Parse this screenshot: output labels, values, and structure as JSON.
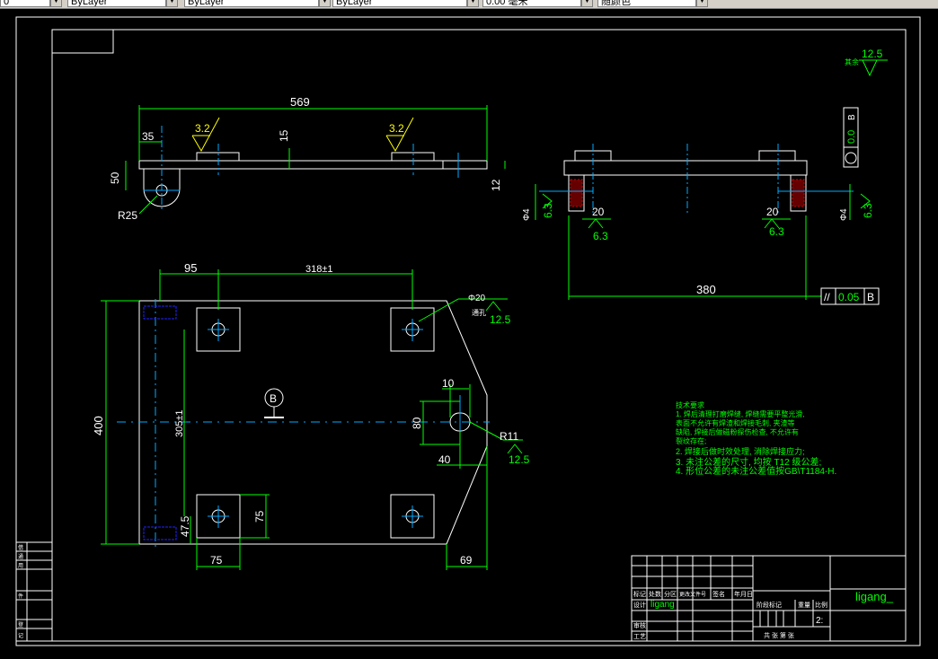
{
  "toolbar": {
    "field1": "0",
    "field2": "ByLayer",
    "field3": "ByLayer",
    "field4": "ByLayer",
    "field5": "0.00 毫米",
    "field6": "随颜色"
  },
  "drawing": {
    "top_view": {
      "dim_overall": "569",
      "dim_offset": "35",
      "dim_height": "50",
      "dim_boss": "15",
      "dim_plate": "12",
      "radius": "R25",
      "rough_left": "3.2",
      "rough_right": "3.2"
    },
    "side_view": {
      "dim_width": "380",
      "dim_left_20": "20",
      "dim_right_20": "20",
      "rough_left": "6.3",
      "rough_right": "6.3",
      "rough_side_left": "6.3",
      "rough_side_right": "6.3",
      "dim_phi_left": "Φ4",
      "dim_phi_right": "Φ4",
      "parallel_tol": "0.05",
      "parallel_datum": "B",
      "flat_tol": "0.0",
      "flat_datum": "B"
    },
    "plan_view": {
      "dim_95": "95",
      "dim_318": "318±1",
      "dim_400": "400",
      "dim_305": "305±1",
      "dim_47": "47.5",
      "dim_75_h": "75",
      "dim_75_v": "75",
      "dim_69": "69",
      "dim_10": "10",
      "dim_80": "80",
      "dim_40": "40",
      "radius": "R11",
      "rough_slot": "12.5",
      "hole_dia": "Φ20",
      "hole_note": "通孔",
      "rough_hole": "12.5",
      "datum": "B"
    },
    "rough_general": "12.5",
    "rough_general_label": "其余",
    "notes": [
      "技术要求",
      "1. 焊后清理打磨焊缝, 焊缝需要平整光滑,",
      "表面不允许有焊渣和焊接毛刺, 夹渣等",
      "缺陷, 焊接后做磁粉探伤检查, 不允许有",
      "裂纹存在;",
      "2. 焊接后做时效处理, 消除焊接应力;",
      "3. 未注公差的尺寸, 均按 T12 级公差;",
      "4. 形位公差的未注公差值按GB\\T1184-H."
    ],
    "title_block": {
      "designer": "ligang",
      "company": "ligang_",
      "scale": "2:",
      "row_labels": [
        "标记",
        "处数",
        "分区",
        "更改文件号",
        "签名",
        "年月日"
      ],
      "left_labels": [
        "设计",
        "审核",
        "工艺"
      ],
      "right_labels": [
        "阶段标记",
        "重量",
        "比例"
      ],
      "bottom": "共 张 第 张"
    },
    "side_panel": [
      "借",
      "通",
      "用",
      "件",
      "登",
      "记"
    ]
  }
}
